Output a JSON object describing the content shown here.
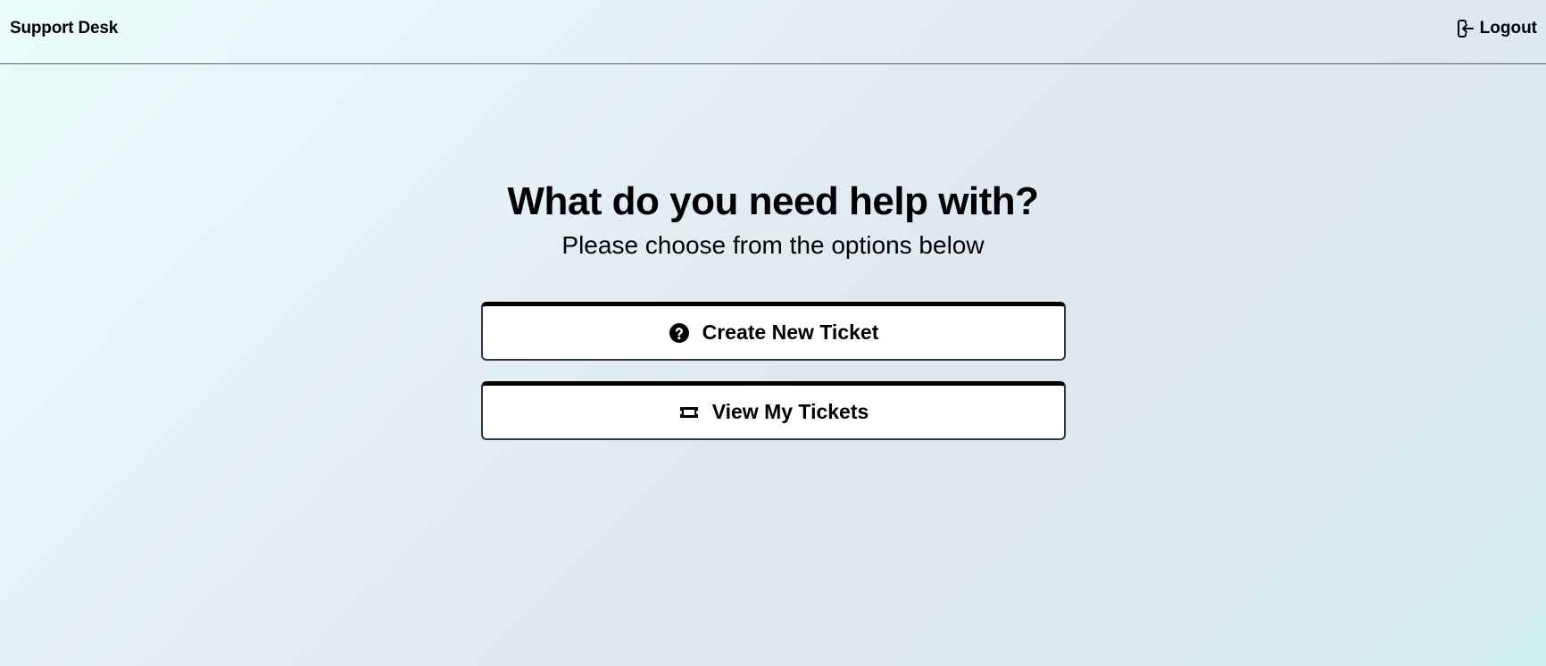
{
  "header": {
    "brand": "Support Desk",
    "logout_label": "Logout",
    "logout_icon": "sign-out-icon"
  },
  "main": {
    "title": "What do you need help with?",
    "subtitle": "Please choose from the options below",
    "options": [
      {
        "label": "Create New Ticket",
        "icon": "question-circle-icon"
      },
      {
        "label": "View My Tickets",
        "icon": "ticket-icon"
      }
    ]
  },
  "colors": {
    "text": "#000000",
    "button_bg": "#ffffff",
    "button_border": "#2f3640",
    "header_rule": "#555f66"
  }
}
